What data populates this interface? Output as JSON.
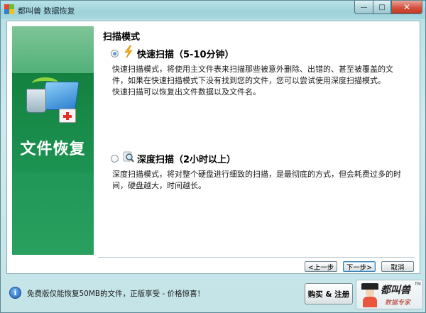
{
  "window": {
    "title": "都叫兽 数据恢复",
    "minimize_glyph": "—",
    "maximize_glyph": "□",
    "close_glyph": "✕"
  },
  "sidebar": {
    "title": "文件恢复",
    "icon": "file-recovery-icon"
  },
  "content": {
    "heading": "扫描模式",
    "options": [
      {
        "title": "快速扫描（5-10分钟）",
        "selected": true,
        "icon": "lightning-icon",
        "description": [
          "快速扫描模式，将使用主文件表来扫描那些被意外删除、出错的、甚至被覆盖的文",
          "件，如果在快速扫描模式下没有找到您的文件，您可以尝试使用深度扫描模式。",
          "快速扫描可以恢复出文件数据以及文件名。"
        ]
      },
      {
        "title": "深度扫描（2小时以上）",
        "selected": false,
        "icon": "magnifier-icon",
        "description": [
          "深度扫描模式，将对整个硬盘进行细致的扫描，是最彻底的方式，但会耗费过多的时",
          "间，硬盘越大，时间越长。"
        ]
      }
    ]
  },
  "nav": {
    "prev_label": "<上一步",
    "next_label": "下一步>",
    "cancel_label": "取消"
  },
  "footer": {
    "info_glyph": "i",
    "notice": "免费版仅能恢复50MB的文件，正版享受 - 价格惊喜！",
    "buy_label": "购买 & 注册",
    "brand_name": "都叫兽",
    "brand_tagline": "数据专家",
    "brand_tm": "TM"
  },
  "colors": {
    "accent_green": "#1f9656",
    "lightning": "#f2b21c",
    "close_red": "#d5513d"
  }
}
